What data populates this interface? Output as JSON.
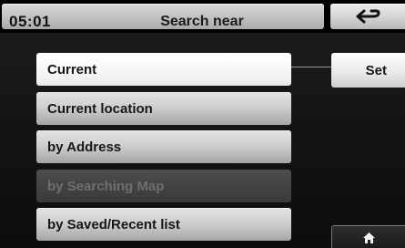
{
  "header": {
    "time": "05:01",
    "title": "Search near",
    "back_icon": "back-arrow-icon"
  },
  "options": [
    {
      "label": "Current",
      "state": "selected"
    },
    {
      "label": "Current location",
      "state": "normal"
    },
    {
      "label": "by Address",
      "state": "normal"
    },
    {
      "label": "by Searching Map",
      "state": "disabled"
    },
    {
      "label": "by Saved/Recent list",
      "state": "normal"
    }
  ],
  "set_button": {
    "label": "Set"
  },
  "home_button": {
    "icon": "home-icon"
  }
}
